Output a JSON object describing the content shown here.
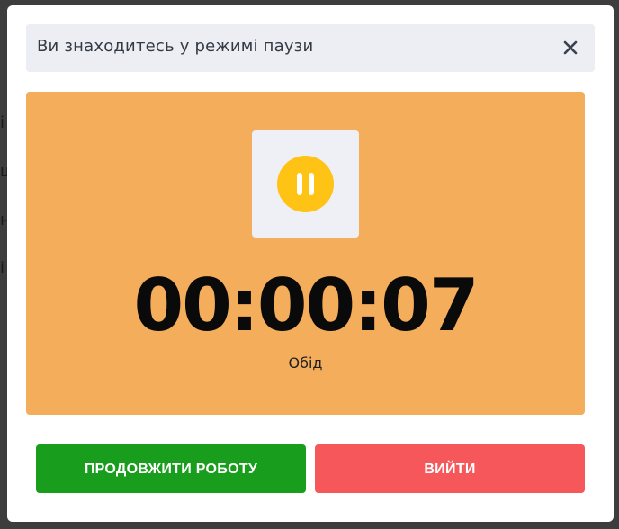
{
  "modal": {
    "title": "Ви знаходитесь у режимі паузи",
    "close_icon": "close-icon"
  },
  "timer": {
    "icon": "pause-icon",
    "value": "00:00:07",
    "reason": "Обід"
  },
  "actions": {
    "continue_label": "ПРОДОВЖИТИ РОБОТУ",
    "exit_label": "ВИЙТИ"
  },
  "colors": {
    "panel": "#f4ad5b",
    "pause_circle": "#fec315",
    "continue": "#189e1c",
    "exit": "#f6575a",
    "header_bg": "#eceef3"
  },
  "background_fragments": [
    "і",
    "ш",
    "н",
    "і"
  ]
}
